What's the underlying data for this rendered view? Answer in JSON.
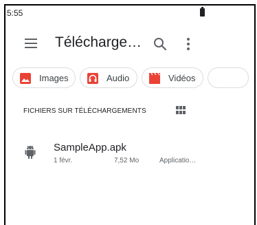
{
  "status_bar": {
    "time": "5:55"
  },
  "app_bar": {
    "title": "Télécharge…"
  },
  "chips": [
    {
      "label": "Images",
      "icon": "image-icon",
      "color": "#ea4335"
    },
    {
      "label": "Audio",
      "icon": "audio-icon",
      "color": "#ea4335"
    },
    {
      "label": "Vidéos",
      "icon": "video-icon",
      "color": "#ea4335"
    }
  ],
  "section": {
    "header": "FICHIERS SUR TÉLÉCHARGEMENTS"
  },
  "files": [
    {
      "name": "SampleApp.apk",
      "date": "1 févr.",
      "size": "7,52 Mo",
      "type": "Applicatio…",
      "icon": "android-icon"
    }
  ],
  "colors": {
    "icon_gray": "#5f6368",
    "chip_red": "#ea4335",
    "chip_border": "#dadce0"
  }
}
